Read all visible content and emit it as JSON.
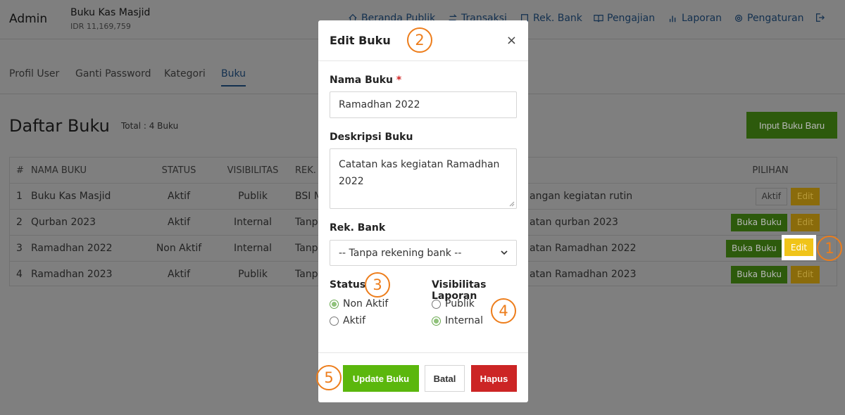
{
  "header": {
    "brand": "Admin",
    "book_name": "Buku Kas Masjid",
    "book_balance": "IDR 11,169,759",
    "nav": [
      {
        "label": "Beranda Publik",
        "icon": "home-icon"
      },
      {
        "label": "Transaksi",
        "icon": "exchange-icon"
      },
      {
        "label": "Rek. Bank",
        "icon": "bank-book-icon"
      },
      {
        "label": "Pengajian",
        "icon": "open-book-icon"
      },
      {
        "label": "Laporan",
        "icon": "bar-chart-icon"
      },
      {
        "label": "Pengaturan",
        "icon": "gear-icon"
      }
    ],
    "logout_icon": "logout-icon"
  },
  "tabs": [
    "Profil User",
    "Ganti Password",
    "Kategori",
    "Buku"
  ],
  "active_tab": "Buku",
  "list": {
    "title": "Daftar Buku",
    "total": "Total : 4 Buku",
    "input_button": "Input Buku Baru",
    "columns": [
      "#",
      "NAMA BUKU",
      "STATUS",
      "VISIBILITAS",
      "REK.",
      "PILIHAN"
    ],
    "rows": [
      {
        "no": "1",
        "nama": "Buku Kas Masjid",
        "status": "Aktif",
        "visibilitas": "Publik",
        "rek": "BSI M",
        "keterangan": "angan kegiatan rutin",
        "actions": [
          "Aktif",
          "Edit"
        ]
      },
      {
        "no": "2",
        "nama": "Qurban 2023",
        "status": "Aktif",
        "visibilitas": "Internal",
        "rek": "Tanpa",
        "keterangan": "atan qurban 2023",
        "actions": [
          "Buka Buku",
          "Edit"
        ]
      },
      {
        "no": "3",
        "nama": "Ramadhan 2022",
        "status": "Non Aktif",
        "visibilitas": "Internal",
        "rek": "Tanpa",
        "keterangan": "atan Ramadhan 2022",
        "actions": [
          "Buka Buku",
          "Edit"
        ]
      },
      {
        "no": "4",
        "nama": "Ramadhan 2023",
        "status": "Aktif",
        "visibilitas": "Publik",
        "rek": "Tanpa",
        "keterangan": "atan Ramadhan 2023",
        "actions": [
          "Buka Buku",
          "Edit"
        ]
      }
    ]
  },
  "modal": {
    "title": "Edit Buku",
    "close": "×",
    "nama_label": "Nama Buku",
    "required_mark": "*",
    "nama_value": "Ramadhan 2022",
    "deskripsi_label": "Deskripsi Buku",
    "deskripsi_value": "Catatan kas kegiatan Ramadhan 2022",
    "rek_label": "Rek. Bank",
    "rek_value": "-- Tanpa rekening bank --",
    "status_label": "Status",
    "status_options": [
      "Non Aktif",
      "Aktif"
    ],
    "status_selected": "Non Aktif",
    "visibilitas_label": "Visibilitas Laporan",
    "visibilitas_options": [
      "Publik",
      "Internal"
    ],
    "visibilitas_selected": "Internal",
    "update_button": "Update Buku",
    "batal_button": "Batal",
    "hapus_button": "Hapus"
  },
  "callouts": [
    "1",
    "2",
    "3",
    "4",
    "5"
  ],
  "colors": {
    "overlay_page": "#7f7f7f",
    "primary_green": "#5bb70d",
    "danger_red": "#cc2525",
    "edit_yellow": "#f0c419",
    "callout_orange": "#ed7d1b",
    "nav_blue": "#13304f"
  }
}
